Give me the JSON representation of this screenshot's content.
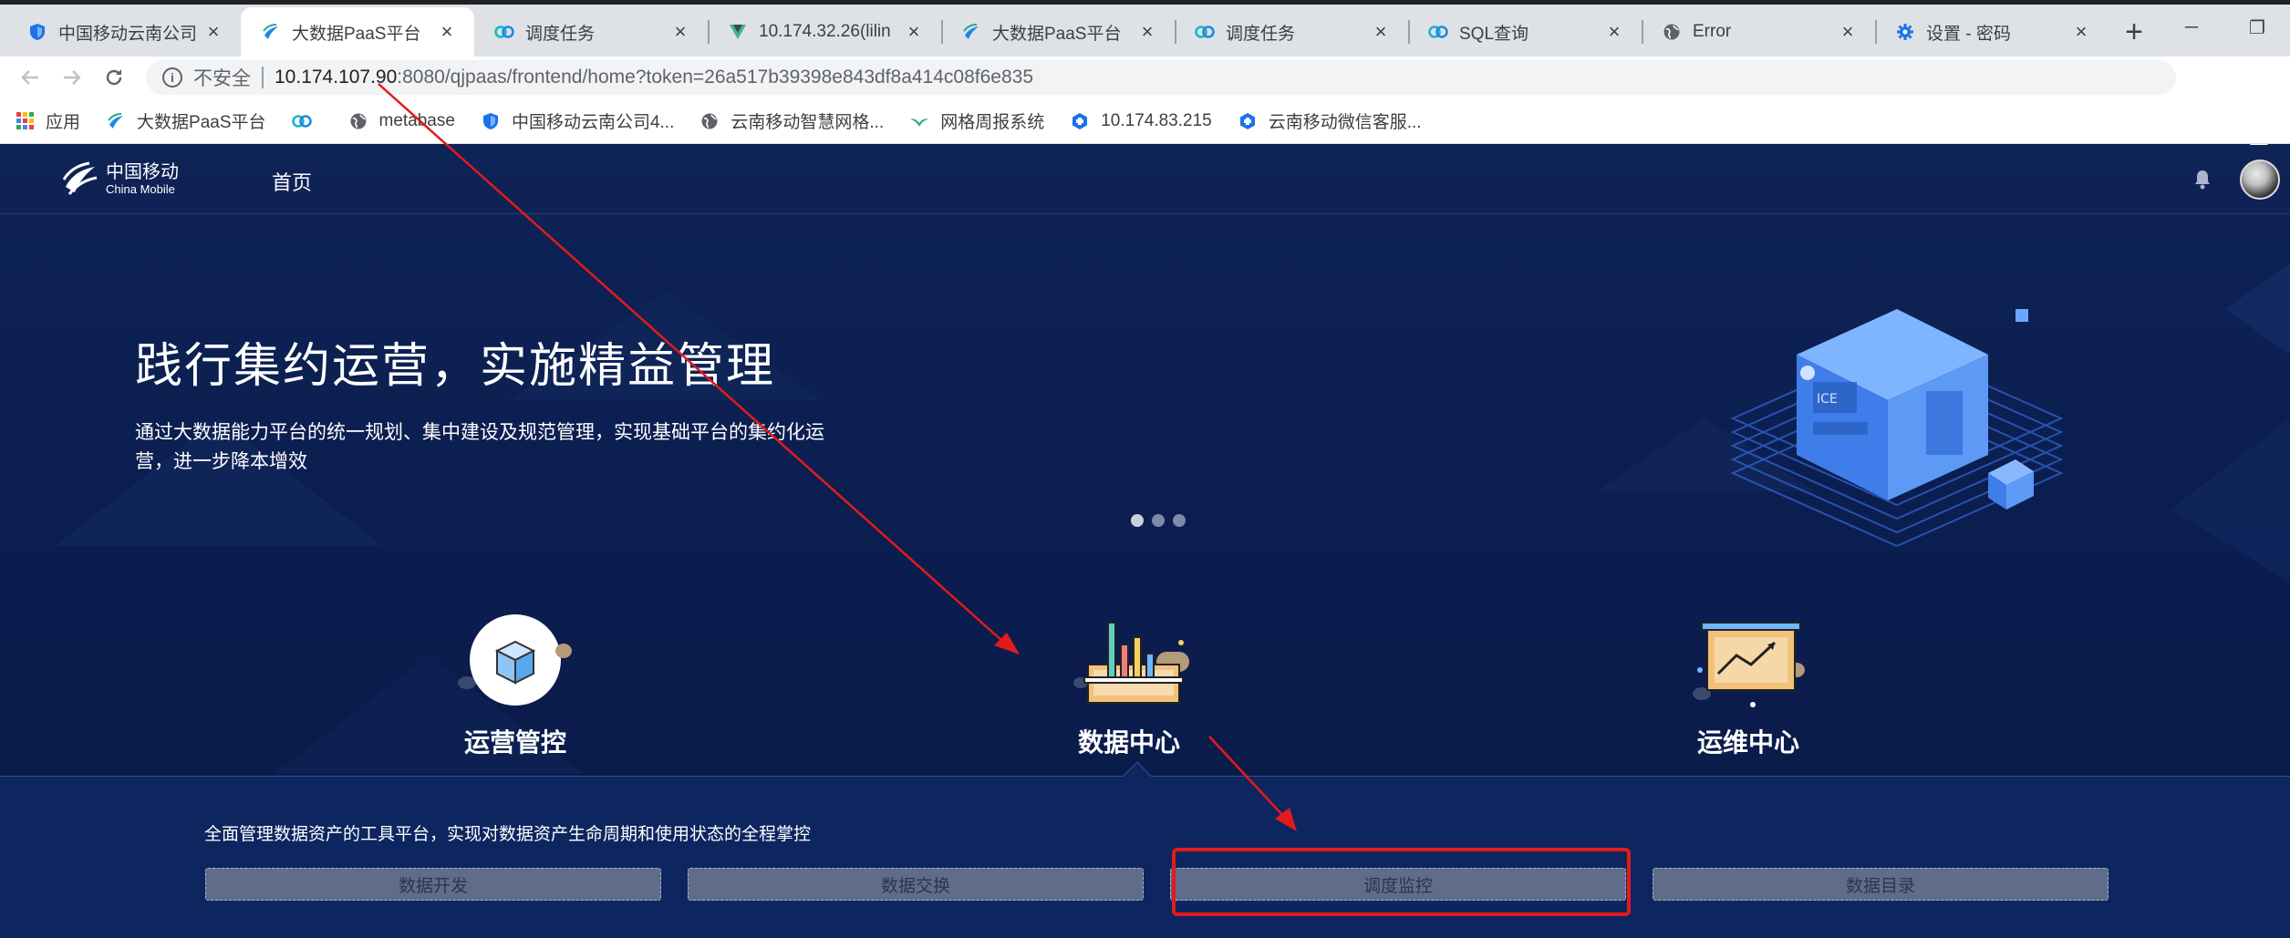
{
  "browser": {
    "tabs": [
      {
        "title": "中国移动云南公司",
        "fav": "shield-icon",
        "active": false
      },
      {
        "title": "大数据PaaS平台",
        "fav": "paas-logo-icon",
        "active": true
      },
      {
        "title": "调度任务",
        "fav": "link-icon",
        "active": false
      },
      {
        "title": "10.174.32.26(lilin",
        "fav": "vue-icon",
        "active": false
      },
      {
        "title": "大数据PaaS平台",
        "fav": "paas-logo-icon",
        "active": false
      },
      {
        "title": "调度任务",
        "fav": "link-icon",
        "active": false
      },
      {
        "title": "SQL查询",
        "fav": "link-icon",
        "active": false
      },
      {
        "title": "Error",
        "fav": "globe-icon",
        "active": false
      },
      {
        "title": "设置 - 密码",
        "fav": "gear-icon",
        "active": false
      }
    ],
    "new_tab": "+",
    "window_controls": {
      "minimize": "─",
      "restore": "❐"
    },
    "omnibox": {
      "security": "不安全",
      "host": "10.174.107.90",
      "path": ":8080/qjpaas/frontend/home?token=26a517b39398e843df8a414c08f6e835"
    },
    "bookmarks": [
      {
        "label": "应用",
        "icon": "apps-grid-icon"
      },
      {
        "label": "大数据PaaS平台",
        "icon": "paas-logo-icon"
      },
      {
        "label": "",
        "icon": "link-icon"
      },
      {
        "label": "metabase",
        "icon": "globe-icon"
      },
      {
        "label": "中国移动云南公司4...",
        "icon": "shield-icon"
      },
      {
        "label": "云南移动智慧网格...",
        "icon": "globe-icon"
      },
      {
        "label": "网格周报系统",
        "icon": "leaf-icon"
      },
      {
        "label": "10.174.83.215",
        "icon": "hex-icon"
      },
      {
        "label": "云南移动微信客服...",
        "icon": "hex-icon"
      }
    ]
  },
  "app": {
    "logo_cn": "中国移动",
    "logo_en": "China Mobile",
    "nav_home": "首页",
    "hero_title": "践行集约运营，实施精益管理",
    "hero_desc_line1": "通过大数据能力平台的统一规划、集中建设及规范管理，实现基础平台的集约化运",
    "hero_desc_line2": "营，进一步降本增效",
    "carousel_dots": 3,
    "features": [
      {
        "label": "运营管控",
        "icon": "cube-circle-icon"
      },
      {
        "label": "数据中心",
        "icon": "bar-chart-board-icon"
      },
      {
        "label": "运维中心",
        "icon": "trend-chart-board-icon"
      }
    ],
    "panel_desc": "全面管理数据资产的工具平台，实现对数据资产生命周期和使用状态的全程掌控",
    "panel_buttons": [
      "数据开发",
      "数据交换",
      "调度监控",
      "数据目录"
    ]
  },
  "colors": {
    "page_bg": "#0b1f4e",
    "annotation_red": "#e41a1a",
    "button_bg": "#5f6d8a"
  }
}
